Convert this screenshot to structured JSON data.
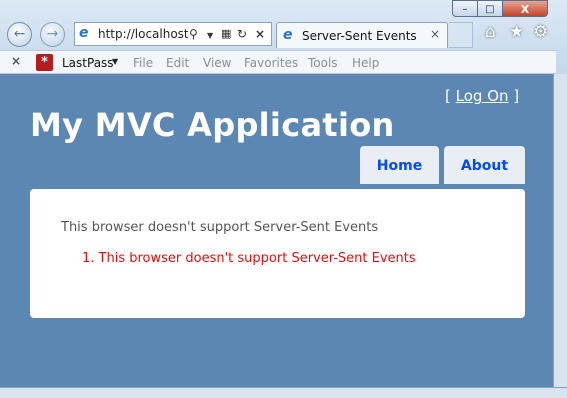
{
  "browser": {
    "window_controls": {
      "minimize": "–",
      "maximize": "□",
      "close": "X"
    },
    "nav": {
      "back_icon": "back-arrow-icon",
      "forward_icon": "forward-arrow-icon"
    },
    "address": {
      "url": "http://localhost:",
      "icons": [
        "search-icon",
        "dropdown-icon",
        "compat-icon",
        "refresh-icon",
        "stop-icon"
      ]
    },
    "tab": {
      "title": "Server-Sent Events"
    },
    "toolbar_icons": [
      "home-icon",
      "star-icon",
      "gear-icon"
    ],
    "command_bar": {
      "lastpass_label": "LastPass",
      "menus": [
        "File",
        "Edit",
        "View",
        "Favorites",
        "Tools",
        "Help"
      ]
    }
  },
  "page": {
    "login": {
      "open_bracket": "[",
      "link": "Log On",
      "close_bracket": "]"
    },
    "title": "My MVC Application",
    "nav": {
      "home": "Home",
      "about": "About"
    },
    "content": {
      "message": "This browser doesn't support Server-Sent Events",
      "list_items": [
        "1.  This browser doesn't support Server-Sent Events"
      ]
    }
  },
  "colors": {
    "page_background": "#5c87b2",
    "error_text": "#dd1111",
    "nav_link": "#034af3"
  }
}
